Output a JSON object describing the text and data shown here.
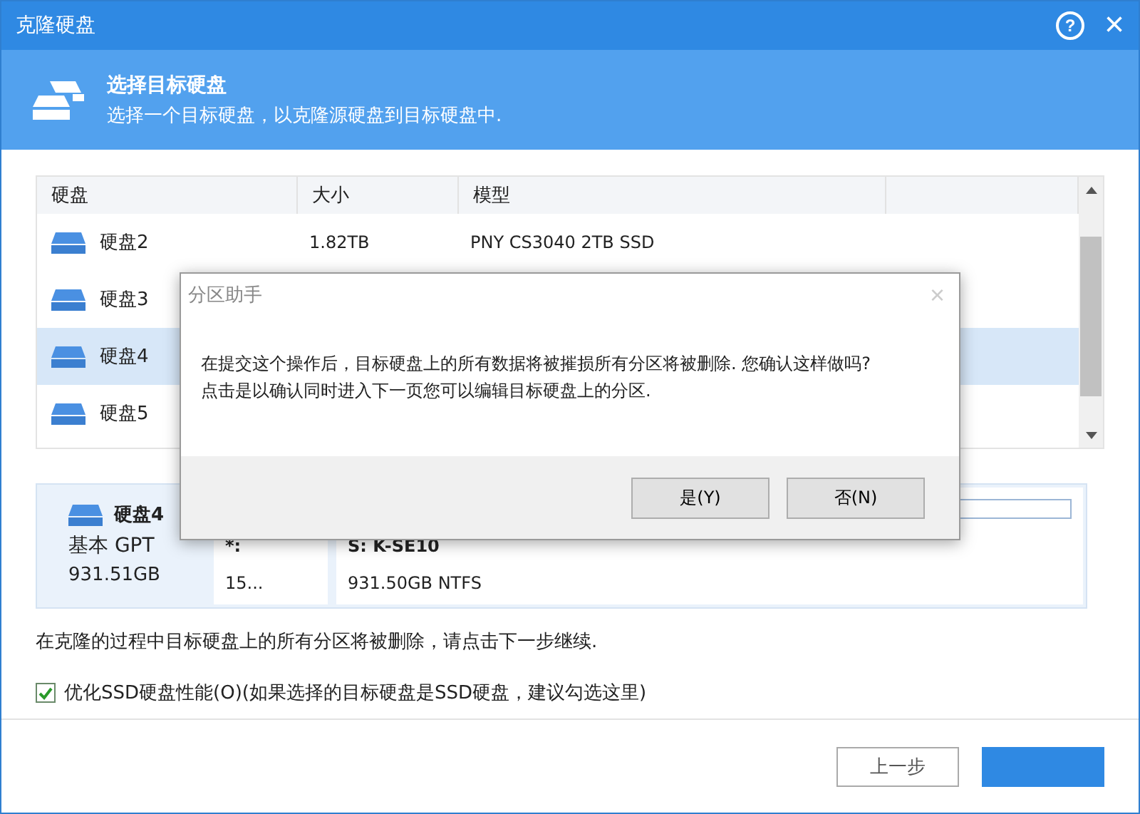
{
  "window": {
    "title": "克隆硬盘",
    "help": "?",
    "close": "×"
  },
  "header": {
    "title": "选择目标硬盘",
    "subtitle": "选择一个目标硬盘，以克隆源硬盘到目标硬盘中."
  },
  "table": {
    "columns": [
      "硬盘",
      "大小",
      "模型"
    ],
    "rows": [
      {
        "disk": "硬盘2",
        "size": "1.82TB",
        "model": "PNY CS3040 2TB SSD",
        "selected": false
      },
      {
        "disk": "硬盘3",
        "selected": false
      },
      {
        "disk": "硬盘4",
        "selected": true
      },
      {
        "disk": "硬盘5",
        "selected": false
      }
    ]
  },
  "disk_panel": {
    "name": "硬盘4",
    "type": "基本 GPT",
    "capacity": "931.51GB",
    "partitions": [
      {
        "label": "*:",
        "detail": "15..."
      },
      {
        "label": "S: K-SE10",
        "detail": "931.50GB NTFS"
      }
    ]
  },
  "notice": "在克隆的过程中目标硬盘上的所有分区将被删除，请点击下一步继续.",
  "option": {
    "label": "优化SSD硬盘性能(O)(如果选择的目标硬盘是SSD硬盘，建议勾选这里)",
    "checked": true
  },
  "buttons": [
    {
      "label": "上一步",
      "kind": "secondary"
    },
    {
      "kind": "primary"
    }
  ],
  "dialog": {
    "title": "分区助手",
    "close": "×",
    "message": [
      "在提交这个操作后，目标硬盘上的所有数据将被摧损所有分区将被删除. 您确认这样做吗?",
      "点击是以确认同时进入下一页您可以编辑目标硬盘上的分区."
    ],
    "buttons": [
      "是(Y)",
      "否(N)"
    ]
  }
}
